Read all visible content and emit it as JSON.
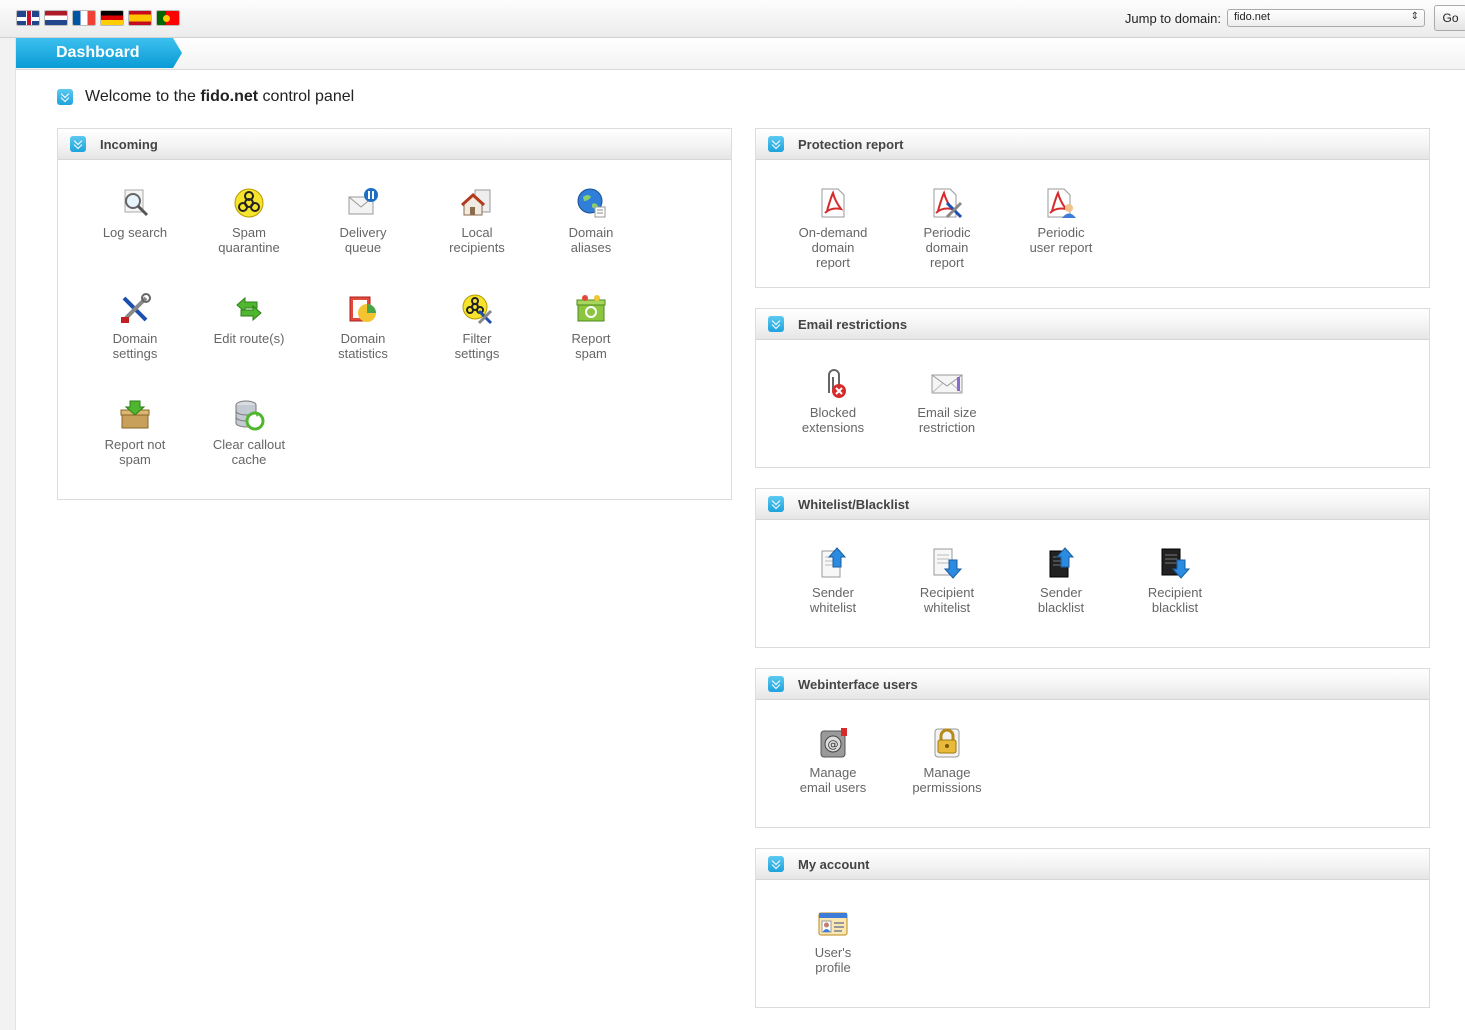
{
  "topbar": {
    "flags": [
      "flag-en",
      "flag-nl",
      "flag-fr",
      "flag-de",
      "flag-es",
      "flag-pt"
    ],
    "jump_label": "Jump to domain:",
    "jump_value": "fido.net",
    "go_label": "Go"
  },
  "tab": {
    "label": "Dashboard"
  },
  "welcome": {
    "prefix": "Welcome to the",
    "domain": "fido.net",
    "suffix": "control panel"
  },
  "panels": {
    "incoming": {
      "title": "Incoming",
      "items": [
        {
          "label": "Log search",
          "icon": "magnifier-icon"
        },
        {
          "label": "Spam\nquarantine",
          "icon": "biohazard-icon"
        },
        {
          "label": "Delivery\nqueue",
          "icon": "envelope-pause-icon"
        },
        {
          "label": "Local\nrecipients",
          "icon": "house-icon"
        },
        {
          "label": "Domain\naliases",
          "icon": "globe-icon"
        },
        {
          "label": "Domain\nsettings",
          "icon": "tools-icon"
        },
        {
          "label": "Edit route(s)",
          "icon": "arrows-icon"
        },
        {
          "label": "Domain\nstatistics",
          "icon": "pie-chart-icon"
        },
        {
          "label": "Filter\nsettings",
          "icon": "biohazard-tools-icon"
        },
        {
          "label": "Report\nspam",
          "icon": "box-recycle-icon"
        },
        {
          "label": "Report not\nspam",
          "icon": "box-download-icon"
        },
        {
          "label": "Clear callout\ncache",
          "icon": "database-refresh-icon"
        }
      ]
    },
    "protection": {
      "title": "Protection report",
      "items": [
        {
          "label": "On-demand\ndomain\nreport",
          "icon": "pdf-icon"
        },
        {
          "label": "Periodic\ndomain\nreport",
          "icon": "pdf-tools-icon"
        },
        {
          "label": "Periodic\nuser report",
          "icon": "pdf-user-icon"
        }
      ]
    },
    "restrictions": {
      "title": "Email restrictions",
      "items": [
        {
          "label": "Blocked\nextensions",
          "icon": "paperclip-blocked-icon"
        },
        {
          "label": "Email size\nrestriction",
          "icon": "envelope-icon"
        }
      ]
    },
    "lists": {
      "title": "Whitelist/Blacklist",
      "items": [
        {
          "label": "Sender\nwhitelist",
          "icon": "doc-arrow-up-icon"
        },
        {
          "label": "Recipient\nwhitelist",
          "icon": "doc-arrow-down-icon"
        },
        {
          "label": "Sender\nblacklist",
          "icon": "black-doc-arrow-up-icon"
        },
        {
          "label": "Recipient\nblacklist",
          "icon": "black-doc-arrow-down-icon"
        }
      ]
    },
    "webusers": {
      "title": "Webinterface users",
      "items": [
        {
          "label": "Manage\nemail users",
          "icon": "at-lock-icon"
        },
        {
          "label": "Manage\npermissions",
          "icon": "padlock-icon"
        }
      ]
    },
    "account": {
      "title": "My account",
      "items": [
        {
          "label": "User's\nprofile",
          "icon": "id-card-icon"
        }
      ]
    }
  },
  "colors": {
    "accent": "#1ea3dc",
    "tab_top": "#3cc0ee",
    "tab_bottom": "#0a9bd6"
  }
}
